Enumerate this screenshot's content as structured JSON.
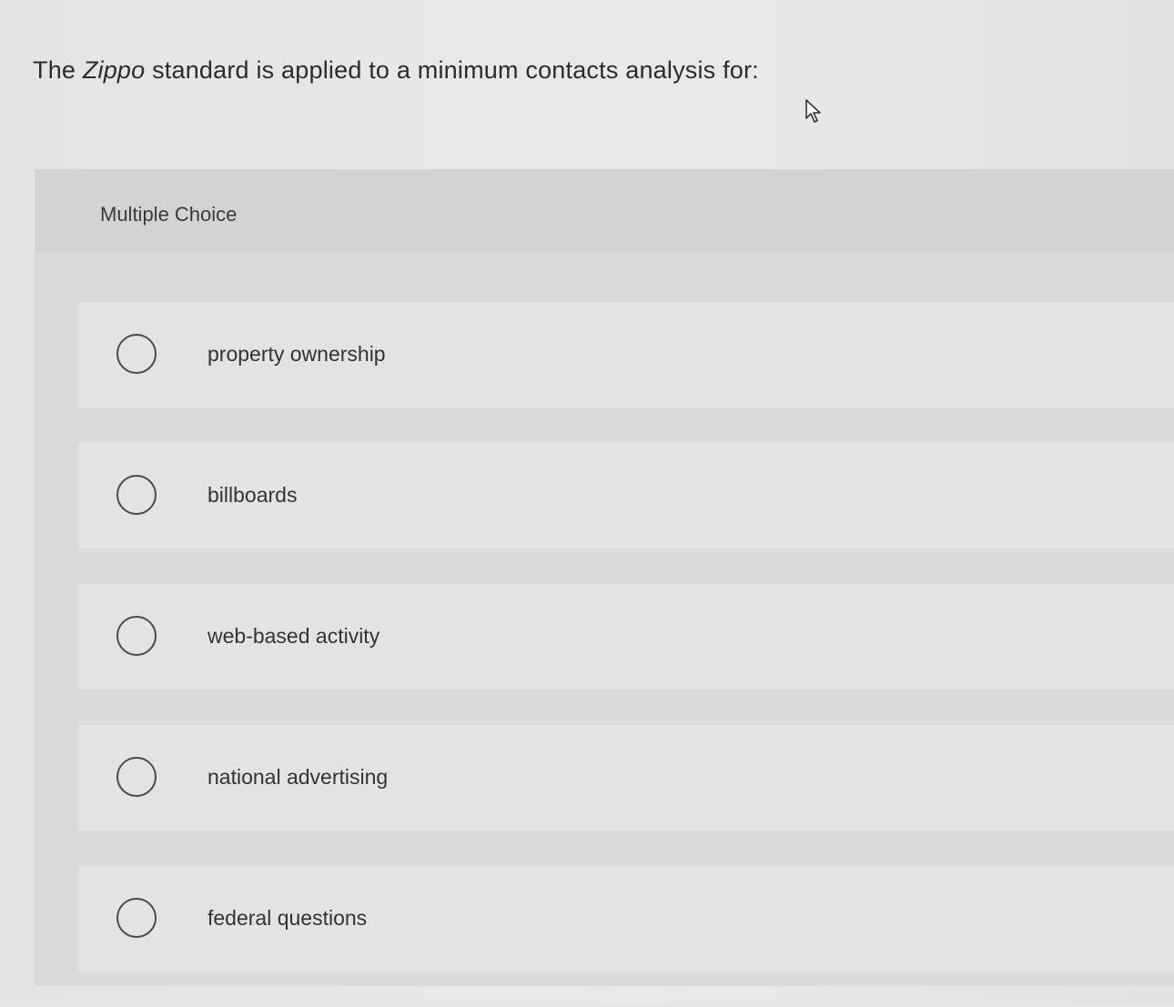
{
  "question": {
    "prefix": "The ",
    "italic": "Zippo",
    "suffix": " standard is applied to a minimum contacts analysis for:"
  },
  "panel": {
    "title": "Multiple Choice"
  },
  "choices": [
    {
      "label": "property ownership"
    },
    {
      "label": "billboards"
    },
    {
      "label": "web-based activity"
    },
    {
      "label": "national advertising"
    },
    {
      "label": "federal questions"
    }
  ]
}
